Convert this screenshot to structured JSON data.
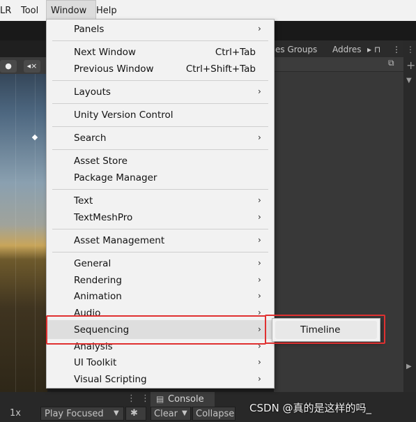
{
  "menubar": {
    "items": [
      "LR",
      "Tool",
      "Window",
      "Help"
    ]
  },
  "right_panel": {
    "tabs": [
      "es Groups",
      "Addres"
    ],
    "icons": [
      "lock-icon",
      "more-icon"
    ]
  },
  "bottom_bar": {
    "speed": "1x",
    "play_focused": "Play Focused",
    "console_tab": "Console",
    "clear": "Clear",
    "collapse": "Collapse"
  },
  "window_menu": {
    "rows": [
      {
        "label": "Panels",
        "submenu": true
      },
      {
        "label": "Next Window",
        "shortcut": "Ctrl+Tab"
      },
      {
        "label": "Previous Window",
        "shortcut": "Ctrl+Shift+Tab"
      },
      {
        "label": "Layouts",
        "submenu": true
      },
      {
        "label": "Unity Version Control"
      },
      {
        "label": "Search",
        "submenu": true
      },
      {
        "label": "Asset Store"
      },
      {
        "label": "Package Manager"
      },
      {
        "label": "Text",
        "submenu": true
      },
      {
        "label": "TextMeshPro",
        "submenu": true
      },
      {
        "label": "Asset Management",
        "submenu": true
      },
      {
        "label": "General",
        "submenu": true
      },
      {
        "label": "Rendering",
        "submenu": true
      },
      {
        "label": "Animation",
        "submenu": true
      },
      {
        "label": "Audio",
        "submenu": true
      },
      {
        "label": "Sequencing",
        "submenu": true,
        "highlighted": true
      },
      {
        "label": "Analysis",
        "submenu": true
      },
      {
        "label": "UI Toolkit",
        "submenu": true
      },
      {
        "label": "Visual Scripting",
        "submenu": true
      }
    ],
    "arrow": "›"
  },
  "submenu": {
    "items": [
      "Timeline"
    ]
  },
  "watermark": "CSDN @真的是这样的吗_",
  "colors": {
    "menu_bg": "#f2f2f2",
    "highlight_bg": "#dedede",
    "annotation_red": "#e03030",
    "editor_dark": "#1f1f1f"
  }
}
